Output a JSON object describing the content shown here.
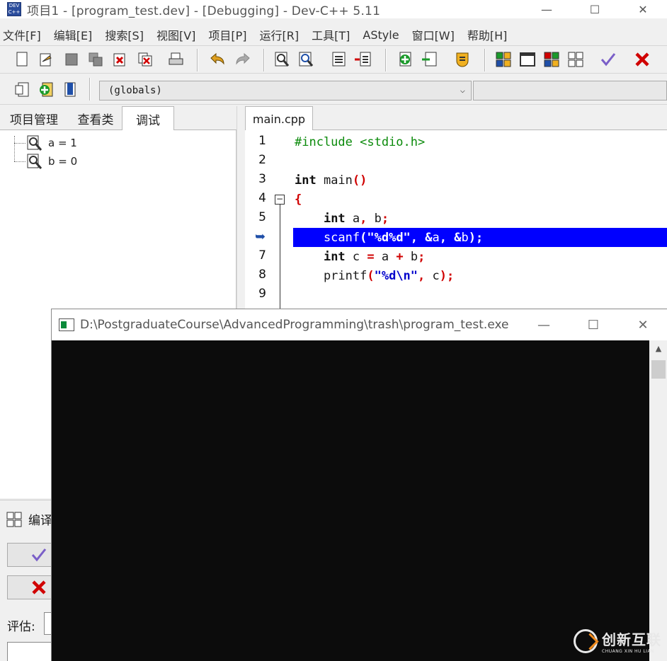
{
  "window": {
    "title": "项目1 - [program_test.dev] - [Debugging] - Dev-C++ 5.11",
    "app_icon_text": "DEV C++",
    "controls": {
      "minimize": "—",
      "maximize": "☐",
      "close": "✕"
    }
  },
  "menu": [
    "文件[F]",
    "编辑[E]",
    "搜索[S]",
    "视图[V]",
    "项目[P]",
    "运行[R]",
    "工具[T]",
    "AStyle",
    "窗口[W]",
    "帮助[H]"
  ],
  "toolbar": {
    "scope": "(globals)",
    "scope_arrow": "⌵"
  },
  "left_panel": {
    "tabs": [
      "项目管理",
      "查看类",
      "调试"
    ],
    "active_tab": "调试",
    "watches": [
      "a = 1",
      "b = 0"
    ]
  },
  "editor": {
    "tab": "main.cpp",
    "line_numbers": [
      "1",
      "2",
      "3",
      "4",
      "5",
      "6",
      "7",
      "8",
      "9"
    ],
    "fold_marker": "−",
    "current_line": 6,
    "breakpoint_marker": "➥"
  },
  "compile_panel": {
    "tab_label": "编译",
    "evaluate_label": "评估:"
  },
  "console": {
    "title": "D:\\PostgraduateCourse\\AdvancedProgramming\\trash\\program_test.exe",
    "controls": {
      "minimize": "—",
      "maximize": "☐",
      "close": "✕"
    },
    "scroll_up": "▲"
  },
  "watermark": {
    "name": "创新互联",
    "sub": "CHUANG XIN HU LIAN"
  },
  "colors": {
    "highlight": "#0000ff",
    "preprocessor": "#0a8a0a",
    "string": "#0000cc",
    "symbol": "#d00000",
    "console_bg": "#0c0c0c"
  }
}
